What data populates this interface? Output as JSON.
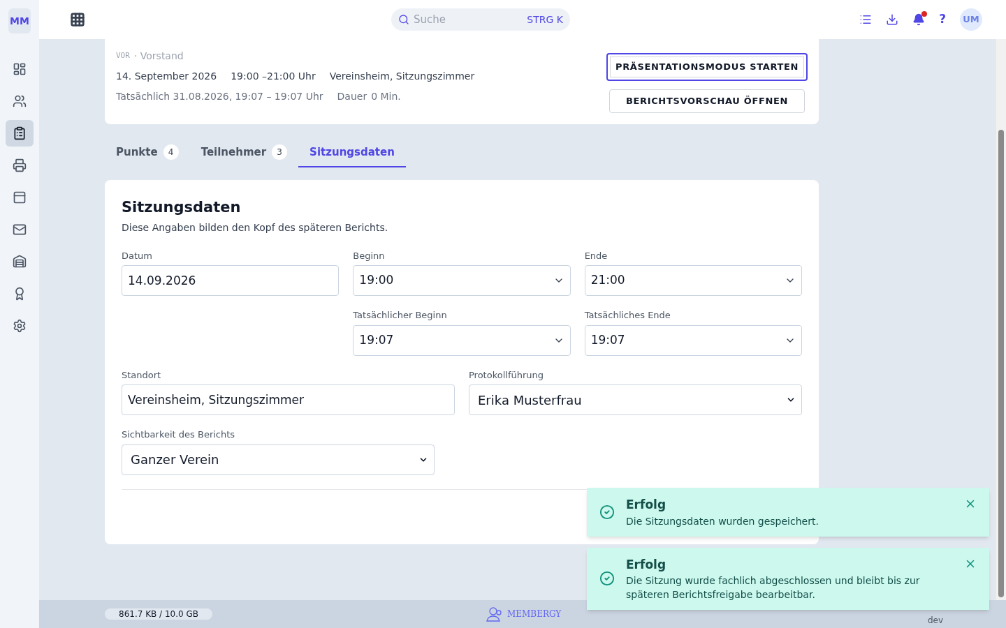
{
  "sidebar": {
    "logo": "MM",
    "items": [
      {
        "selected": false
      },
      {
        "selected": false
      },
      {
        "selected": true
      },
      {
        "selected": false
      },
      {
        "selected": false
      },
      {
        "selected": false
      },
      {
        "selected": false
      },
      {
        "selected": false
      },
      {
        "selected": false
      }
    ]
  },
  "header": {
    "search": {
      "placeholder": "Suche",
      "shortcut": "STRG K"
    },
    "notifications_unread": true,
    "help": "?",
    "avatar": "UM"
  },
  "meeting": {
    "group_code": "VOR",
    "group": "· Vorstand",
    "date": "14. September 2026",
    "time": "19:00 –21:00 Uhr",
    "location": "Vereinsheim, Sitzungszimmer",
    "actual": "Tatsächlich 31.08.2026, 19:07 – 19:07 Uhr",
    "duration_label": "Dauer",
    "duration": "0 Min.",
    "actions": [
      {
        "label": "PRÄSENTATIONSMODUS STARTEN",
        "focused": true
      },
      {
        "label": "BERICHTSVORSCHAU ÖFFNEN",
        "focused": false
      }
    ]
  },
  "tabs": [
    {
      "label": "Punkte",
      "count": "4",
      "selected": false
    },
    {
      "label": "Teilnehmer",
      "count": "3",
      "selected": false
    },
    {
      "label": "Sitzungsdaten",
      "selected": true
    }
  ],
  "form": {
    "title": "Sitzungsdaten",
    "subtitle": "Diese Angaben bilden den Kopf des späteren Berichts.",
    "rows": [
      {
        "fields": [
          {
            "label": "Datum",
            "value": "14.09.2026",
            "kind": "text"
          },
          {
            "label": "Beginn",
            "value": "19:00",
            "kind": "time"
          },
          {
            "label": "Ende",
            "value": "21:00",
            "kind": "time"
          }
        ]
      },
      {
        "fields": [
          {
            "kind": "empty"
          },
          {
            "label": "Tatsächlicher Beginn",
            "value": "19:07",
            "kind": "time"
          },
          {
            "label": "Tatsächliches Ende",
            "value": "19:07",
            "kind": "time"
          }
        ]
      },
      {
        "fields": [
          {
            "label": "Standort",
            "value": "Vereinsheim, Sitzungszimmer",
            "kind": "text"
          },
          {
            "label": "Protokollführung",
            "value": "Erika Musterfrau",
            "kind": "select"
          }
        ]
      },
      {
        "fields": [
          {
            "label": "Sichtbarkeit des Berichts",
            "value": "Ganzer Verein",
            "kind": "select"
          },
          {
            "kind": "empty"
          }
        ]
      }
    ]
  },
  "toasts": [
    {
      "title": "Erfolg",
      "message": "Die Sitzungsdaten wurden gespeichert."
    },
    {
      "title": "Erfolg",
      "message": "Die Sitzung wurde fachlich abgeschlossen und bleibt bis zur späteren Berichtsfreigabe bearbeitbar."
    }
  ],
  "footer": {
    "storage": "861.7 KB / 10.0 GB",
    "brand": "MEMBERGY",
    "env": "dev"
  }
}
